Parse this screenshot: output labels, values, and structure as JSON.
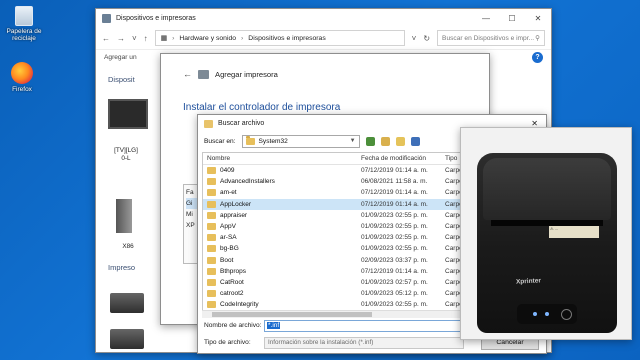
{
  "desktop": {
    "recycle_bin_label": "Papelera de reciclaje",
    "firefox_label": "Firefox"
  },
  "explorer": {
    "title": "Dispositivos e impresoras",
    "breadcrumb": [
      "Hardware y sonido",
      "Dispositivos e impresoras"
    ],
    "search_placeholder": "Buscar en Dispositivos e impr...",
    "toolbar_item": "Agregar un",
    "section_devices": "Disposit",
    "section_printers": "Impreso",
    "device_monitor_label": "[TV][LG]\n0-L",
    "device_pc_label": "X86",
    "help_label": "?"
  },
  "add_printer": {
    "title": "Agregar impresora",
    "heading": "Instalar el controlador de impresora",
    "side_items": [
      "Fa",
      "Gi",
      "Mi",
      "XP"
    ]
  },
  "file_dialog": {
    "title": "Buscar archivo",
    "look_in_label": "Buscar en:",
    "look_in_value": "System32",
    "columns": {
      "name": "Nombre",
      "date": "Fecha de modificación",
      "type": "Tipo"
    },
    "rows": [
      {
        "name": "0409",
        "date": "07/12/2019 01:14 a. m.",
        "type": "Carpeta"
      },
      {
        "name": "AdvancedInstallers",
        "date": "06/08/2021 11:58 a. m.",
        "type": "Carpeta"
      },
      {
        "name": "am-et",
        "date": "07/12/2019 01:14 a. m.",
        "type": "Carpeta"
      },
      {
        "name": "AppLocker",
        "date": "07/12/2019 01:14 a. m.",
        "type": "Carpeta",
        "selected": true
      },
      {
        "name": "appraiser",
        "date": "01/09/2023 02:55 p. m.",
        "type": "Carpeta"
      },
      {
        "name": "AppV",
        "date": "01/09/2023 02:55 p. m.",
        "type": "Carpeta"
      },
      {
        "name": "ar-SA",
        "date": "01/09/2023 02:55 p. m.",
        "type": "Carpeta"
      },
      {
        "name": "bg-BG",
        "date": "01/09/2023 02:55 p. m.",
        "type": "Carpeta"
      },
      {
        "name": "Boot",
        "date": "02/09/2023 03:37 p. m.",
        "type": "Carpeta"
      },
      {
        "name": "Bthprops",
        "date": "07/12/2019 01:14 a. m.",
        "type": "Carpeta"
      },
      {
        "name": "CatRoot",
        "date": "01/09/2023 02:57 p. m.",
        "type": "Carpeta"
      },
      {
        "name": "catroot2",
        "date": "01/09/2023 05:12 p. m.",
        "type": "Carpeta"
      },
      {
        "name": "CodeIntegrity",
        "date": "01/09/2023 02:55 p. m.",
        "type": "Carpeta"
      }
    ],
    "file_name_label": "Nombre de archivo:",
    "file_name_value": "*.inf",
    "file_type_label": "Tipo de archivo:",
    "file_type_value": "Información sobre la instalación (*.inf)",
    "cancel_label": "Cancelar"
  },
  "photo": {
    "brand": "Xprinter",
    "warning_label": "⚠ ..."
  }
}
